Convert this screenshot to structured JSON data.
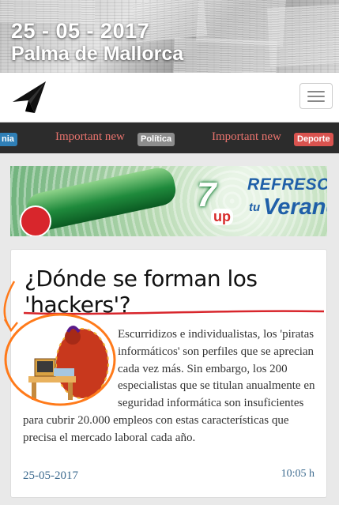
{
  "banner": {
    "date": "25 - 05 - 2017",
    "city": "Palma de Mallorca"
  },
  "navbar": {
    "logo_icon": "paper-plane-icon",
    "menu_icon": "hamburger-icon"
  },
  "ticker": {
    "items": [
      {
        "badge": "nia",
        "badge_color": "#2f7fb6"
      },
      {
        "text": "Important new",
        "badge": "Política",
        "badge_color": "#8c8c8c"
      },
      {
        "text": "Important new",
        "badge": "Deporte",
        "badge_color": "#d9534f"
      }
    ]
  },
  "ad": {
    "brand": "7",
    "brand_suffix": "up",
    "headline": "REFRESCA",
    "tagline_small": "tu",
    "tagline": "Verano"
  },
  "article": {
    "title": "¿Dónde se forman los 'hackers'?",
    "body": "Escurridizos e individualistas, los 'piratas informáticos' son perfiles que se aprecian cada vez más. Sin embargo, los 200 especialistas que se titulan anualmente en seguridad informática son insuficientes para cubrir 20.000 empleos con estas características que precisa el mercado laboral cada año.",
    "date": "25-05-2017",
    "time": "10:05 h",
    "date_color": "#3d6b8f"
  },
  "annotations": {
    "color": "#ff7a1a",
    "underline_color": "#d8262c"
  }
}
